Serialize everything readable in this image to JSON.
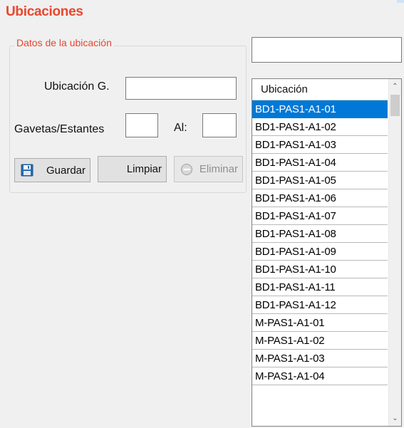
{
  "title": "Ubicaciones",
  "group": {
    "legend": "Datos de la ubicación"
  },
  "form": {
    "ubicacion_label": "Ubicación G.",
    "ubicacion_value": "",
    "gavetas_label": "Gavetas/Estantes",
    "gavetas_from_value": "",
    "al_label": "Al:",
    "gavetas_to_value": ""
  },
  "search": {
    "value": ""
  },
  "buttons": {
    "guardar": "Guardar",
    "limpiar": "Limpiar",
    "eliminar": "Eliminar"
  },
  "list": {
    "header": "Ubicación",
    "selected_index": 0,
    "items": [
      "BD1-PAS1-A1-01",
      "BD1-PAS1-A1-02",
      "BD1-PAS1-A1-03",
      "BD1-PAS1-A1-04",
      "BD1-PAS1-A1-05",
      "BD1-PAS1-A1-06",
      "BD1-PAS1-A1-07",
      "BD1-PAS1-A1-08",
      "BD1-PAS1-A1-09",
      "BD1-PAS1-A1-10",
      "BD1-PAS1-A1-11",
      "BD1-PAS1-A1-12",
      "M-PAS1-A1-01",
      "M-PAS1-A1-02",
      "M-PAS1-A1-03",
      "M-PAS1-A1-04"
    ]
  },
  "colors": {
    "accent": "#e8472f",
    "selection": "#0078d7"
  }
}
